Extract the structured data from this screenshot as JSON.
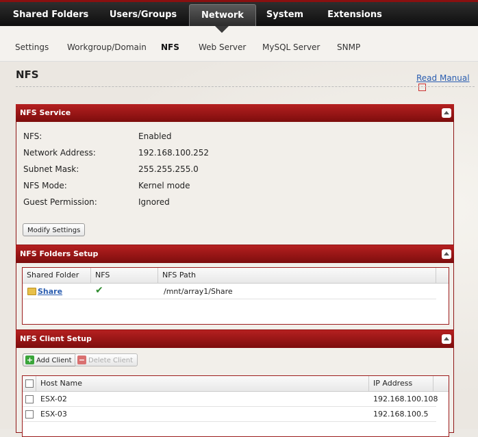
{
  "topnav": {
    "tabs": [
      {
        "label": "Shared Folders"
      },
      {
        "label": "Users/Groups"
      },
      {
        "label": "Network"
      },
      {
        "label": "System"
      },
      {
        "label": "Extensions"
      }
    ]
  },
  "subnav": {
    "items": [
      {
        "label": "Settings"
      },
      {
        "label": "Workgroup/Domain"
      },
      {
        "label": "NFS"
      },
      {
        "label": "Web Server"
      },
      {
        "label": "MySQL Server"
      },
      {
        "label": "SNMP"
      }
    ]
  },
  "page": {
    "title": "NFS",
    "read_manual": "Read Manual"
  },
  "nfs_service": {
    "title": "NFS Service",
    "rows": [
      {
        "label": "NFS:",
        "value": "Enabled"
      },
      {
        "label": "Network Address:",
        "value": "192.168.100.252"
      },
      {
        "label": "Subnet Mask:",
        "value": "255.255.255.0"
      },
      {
        "label": "NFS Mode:",
        "value": "Kernel mode"
      },
      {
        "label": "Guest Permission:",
        "value": "Ignored"
      }
    ],
    "modify_button": "Modify Settings"
  },
  "nfs_folders": {
    "title": "NFS Folders Setup",
    "columns": [
      "Shared Folder",
      "NFS",
      "NFS Path"
    ],
    "rows": [
      {
        "folder": "Share",
        "nfs": "✔",
        "path": "/mnt/array1/Share"
      }
    ]
  },
  "nfs_clients": {
    "title": "NFS Client Setup",
    "add_button": "Add Client",
    "delete_button": "Delete Client",
    "columns": [
      "Host Name",
      "IP Address"
    ],
    "rows": [
      {
        "host": "ESX-02",
        "ip": "192.168.100.108"
      },
      {
        "host": "ESX-03",
        "ip": "192.168.100.5"
      }
    ]
  },
  "colors": {
    "accent": "#8e1414",
    "link": "#2a5db0",
    "check": "#2e8b2e"
  }
}
